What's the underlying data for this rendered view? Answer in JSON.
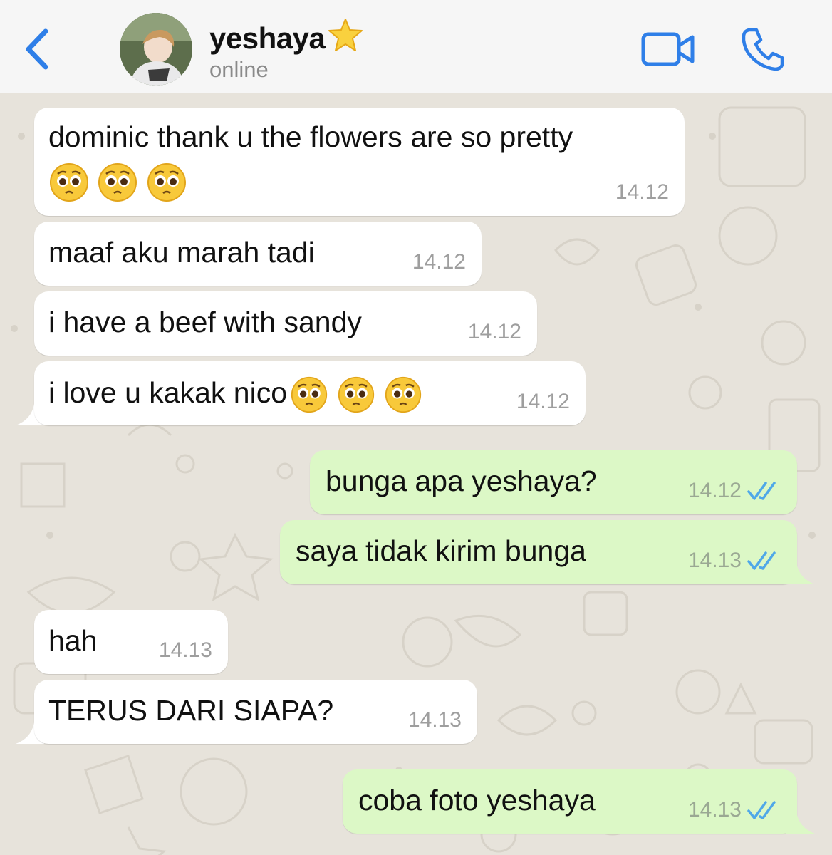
{
  "header": {
    "back_icon": "chevron-left-icon",
    "contact_name": "yeshaya",
    "contact_name_icon": "star-emoji-icon",
    "status": "online",
    "video_icon": "video-camera-icon",
    "call_icon": "phone-icon",
    "accent_color": "#2f7fe8"
  },
  "colors": {
    "incoming_bubble": "#ffffff",
    "outgoing_bubble": "#dcf8c6",
    "read_ticks": "#4fa8e8",
    "wallpaper": "#e7e3db"
  },
  "messages": [
    {
      "direction": "incoming",
      "text": "dominic thank u the flowers are so pretty",
      "emojis": [
        "pleading-face-emoji",
        "pleading-face-emoji",
        "pleading-face-emoji"
      ],
      "time": "14.12"
    },
    {
      "direction": "incoming",
      "text": "maaf aku marah tadi",
      "time": "14.12"
    },
    {
      "direction": "incoming",
      "text": "i have a beef with sandy",
      "time": "14.12"
    },
    {
      "direction": "incoming",
      "text": "i love u kakak nico",
      "emojis": [
        "pleading-face-emoji",
        "pleading-face-emoji",
        "pleading-face-emoji"
      ],
      "time": "14.12"
    },
    {
      "direction": "outgoing",
      "text": "bunga apa yeshaya?",
      "time": "14.12",
      "status": "read"
    },
    {
      "direction": "outgoing",
      "text": "saya tidak kirim bunga",
      "time": "14.13",
      "status": "read"
    },
    {
      "direction": "incoming",
      "text": "hah",
      "time": "14.13"
    },
    {
      "direction": "incoming",
      "text": "TERUS DARI SIAPA?",
      "time": "14.13"
    },
    {
      "direction": "outgoing",
      "text": "coba foto yeshaya",
      "time": "14.13",
      "status": "read"
    }
  ]
}
